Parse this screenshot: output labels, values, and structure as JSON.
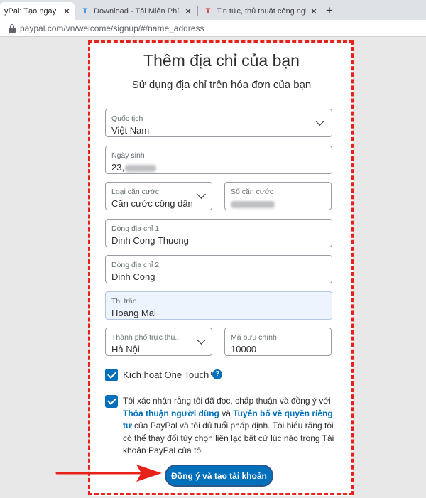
{
  "browser": {
    "tabs": [
      {
        "title": "yPal: Tạo ngay một tài",
        "icon": "paypal-favicon",
        "active": true
      },
      {
        "title": "Download - Tải Miễn Phí VN - Ph",
        "icon": "t-favicon-blue",
        "active": false
      },
      {
        "title": "Tin tức, thủ thuật công nghệ mớ",
        "icon": "t-favicon-red",
        "active": false
      }
    ],
    "new_tab": "+",
    "url": "paypal.com/vn/welcome/signup/#/name_address"
  },
  "form": {
    "title": "Thêm địa chỉ của bạn",
    "subtitle": "Sử dụng địa chỉ trên hóa đơn của bạn",
    "nationality": {
      "label": "Quốc tịch",
      "value": "Việt Nam"
    },
    "dob": {
      "label": "Ngày sinh",
      "value_prefix": "23,"
    },
    "id_type": {
      "label": "Loại căn cước",
      "value": "Căn cước công dân"
    },
    "id_number": {
      "label": "Số căn cước"
    },
    "address1": {
      "label": "Dòng địa chỉ 1",
      "value": "Dinh Cong Thuong"
    },
    "address2": {
      "label": "Dòng địa chỉ 2",
      "value": "Dinh Cong"
    },
    "town": {
      "label": "Thị trấn",
      "value": "Hoang Mai"
    },
    "city": {
      "label": "Thành phố trực thu...",
      "value": "Hà Nội"
    },
    "postal": {
      "label": "Mã bưu chính",
      "value": "10000"
    },
    "onetouch_label": "Kích hoạt One Touch™",
    "help_glyph": "?",
    "consent": {
      "part1": "Tôi xác nhận rằng tôi đã đọc, chấp thuận và đồng ý với ",
      "link1": "Thỏa thuận người dùng",
      "part2": " và ",
      "link2": "Tuyên bố về quyền riêng tư",
      "part3": " của PayPal và tôi đủ tuổi pháp định. Tôi hiểu rằng tôi có thể thay đổi tùy chọn liên lạc bất cứ lúc nào trong Tài khoản PayPal của tôi."
    },
    "submit_label": "Đồng ý và tạo tài khoản"
  },
  "colors": {
    "accent": "#0070ba",
    "annotation": "#e8211b",
    "filled_field": "#eef4fd"
  }
}
